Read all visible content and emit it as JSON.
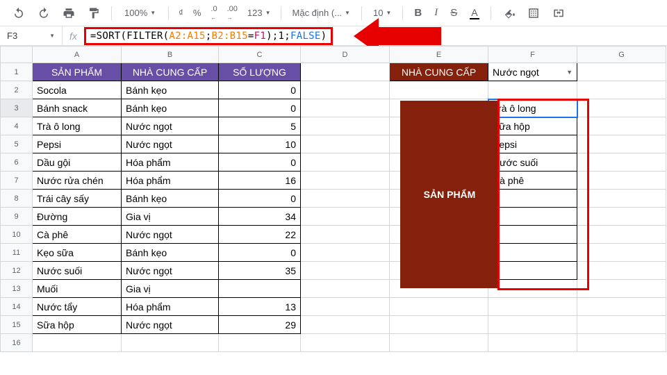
{
  "toolbar": {
    "zoom": "100%",
    "currency": "₫",
    "percent": "%",
    "dec_dec": ".0",
    "dec_inc": ".00",
    "more_fmt": "123",
    "font": "Mặc định (...",
    "font_size": "10",
    "bold": "B",
    "italic": "I",
    "strike": "S",
    "text_color": "A"
  },
  "namebox": "F3",
  "formula": {
    "p1": "=SORT(FILTER(",
    "r1": "A2:A15",
    "sep1": ";",
    "r2": "B2:B15",
    "eq": "=",
    "ref": "F1",
    "p2": ");1;",
    "bool": "FALSE",
    "p3": ")"
  },
  "cols": [
    "A",
    "B",
    "C",
    "D",
    "E",
    "F",
    "G"
  ],
  "headers": {
    "a": "SẢN PHẨM",
    "b": "NHÀ CUNG CẤP",
    "c": "SỐ LƯỢNG",
    "e": "NHÀ CUNG CẤP",
    "f": "Nước ngọt"
  },
  "table": [
    {
      "a": "Socola",
      "b": "Bánh kẹo",
      "c": "0"
    },
    {
      "a": "Bánh snack",
      "b": "Bánh kẹo",
      "c": "0"
    },
    {
      "a": "Trà ô long",
      "b": "Nước ngọt",
      "c": "5"
    },
    {
      "a": "Pepsi",
      "b": "Nước ngọt",
      "c": "10"
    },
    {
      "a": "Dầu gội",
      "b": "Hóa phẩm",
      "c": "0"
    },
    {
      "a": "Nước rửa chén",
      "b": "Hóa phẩm",
      "c": "16"
    },
    {
      "a": "Trái cây sấy",
      "b": "Bánh kẹo",
      "c": "0"
    },
    {
      "a": "Đường",
      "b": "Gia vị",
      "c": "34"
    },
    {
      "a": "Cà phê",
      "b": "Nước ngọt",
      "c": "22"
    },
    {
      "a": "Kẹo sữa",
      "b": "Bánh kẹo",
      "c": "0"
    },
    {
      "a": "Nước suối",
      "b": "Nước ngọt",
      "c": "35"
    },
    {
      "a": "Muối",
      "b": "Gia vị",
      "c": ""
    },
    {
      "a": "Nước tẩy",
      "b": "Hóa phẩm",
      "c": "13"
    },
    {
      "a": "Sữa hộp",
      "b": "Nước ngọt",
      "c": "29"
    }
  ],
  "results_label": "SẢN PHẨM",
  "results": [
    "Trà ô long",
    "Sữa hộp",
    "Pepsi",
    "Nước suối",
    "Cà phê",
    "",
    "",
    "",
    "",
    ""
  ]
}
